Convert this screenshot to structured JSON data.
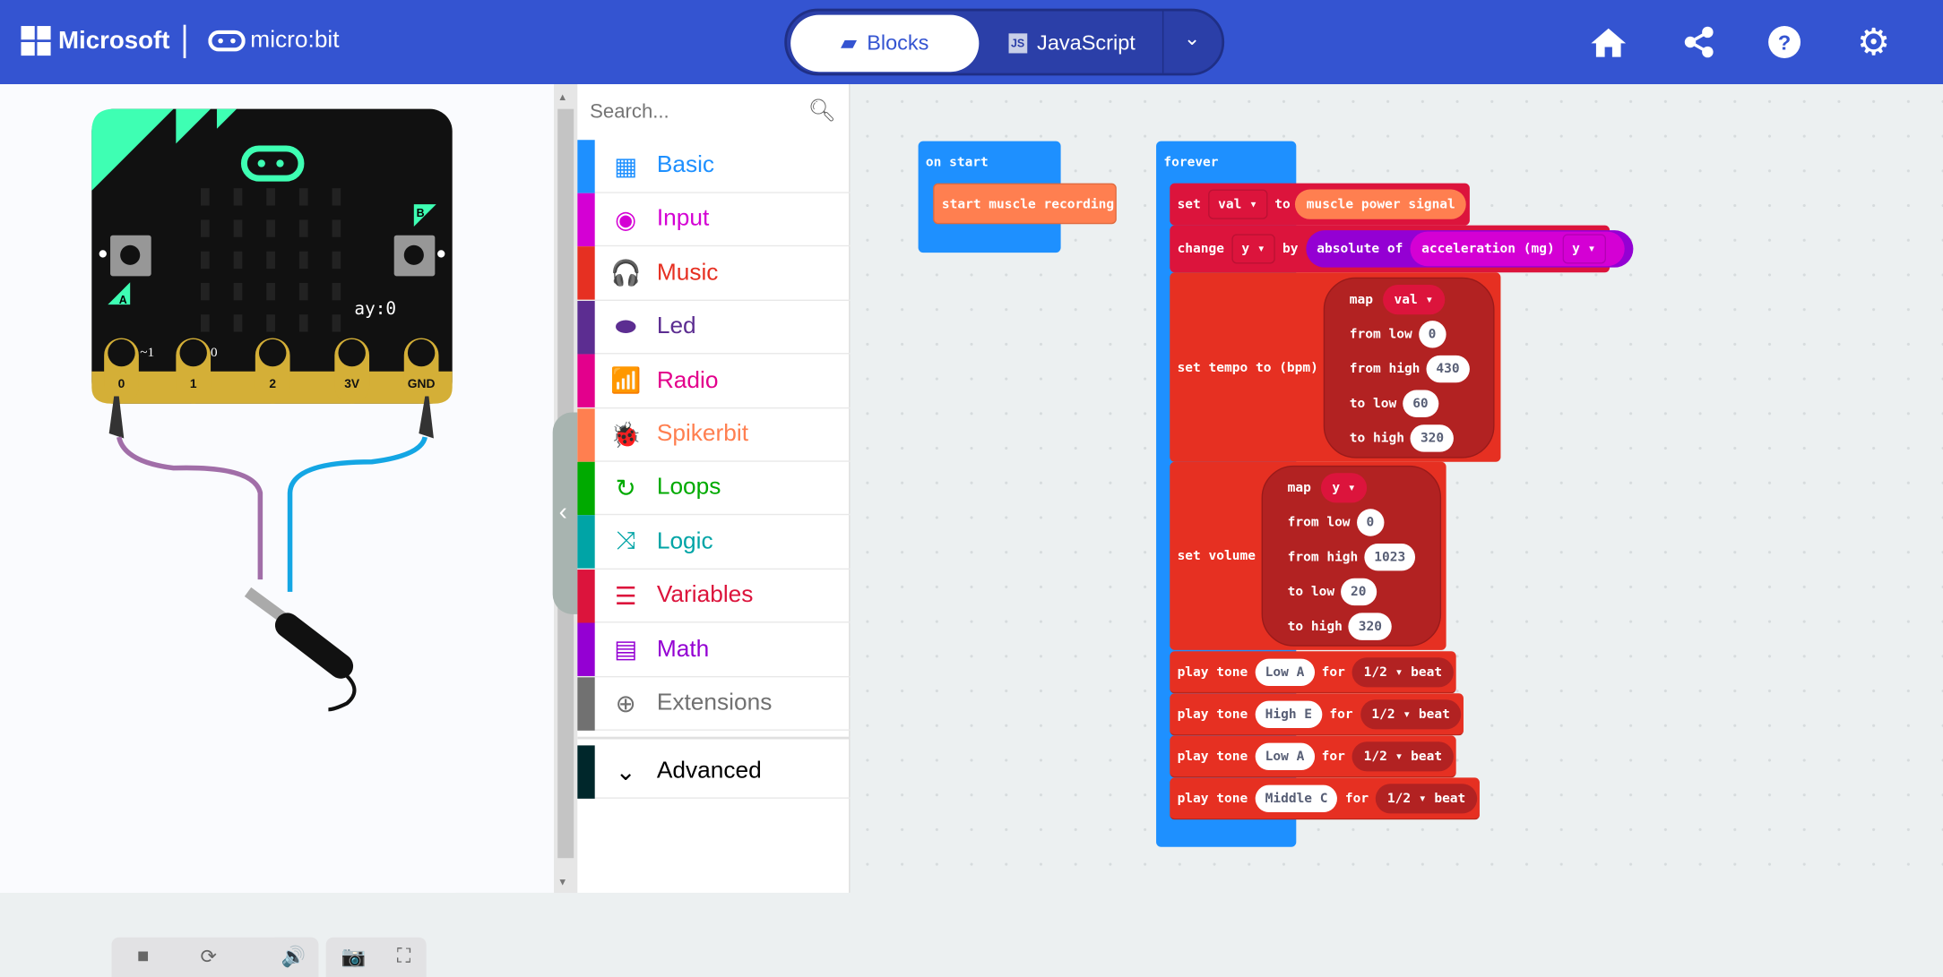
{
  "header": {
    "brand": "Microsoft",
    "product": "micro:bit",
    "tabs": [
      {
        "label": "Blocks",
        "icon": "puzzle-icon"
      },
      {
        "label": "JavaScript",
        "icon": "js-icon"
      }
    ],
    "icons": [
      "home-icon",
      "share-icon",
      "help-icon",
      "settings-icon"
    ],
    "color": "#3454d1"
  },
  "simulator": {
    "readout": "ay:0",
    "pin_labels": [
      "0",
      "1",
      "2",
      "3V",
      "GND"
    ],
    "pin_values": [
      "~1",
      "0"
    ],
    "buttons": [
      "A",
      "B"
    ],
    "controls": [
      "stop-icon",
      "restart-icon",
      "debug-icon",
      "sound-icon",
      "screenshot-icon",
      "fullscreen-icon"
    ]
  },
  "toolbox": {
    "search_placeholder": "Search...",
    "items": [
      {
        "label": "Basic",
        "color": "#1e90ff"
      },
      {
        "label": "Input",
        "color": "#d400d4"
      },
      {
        "label": "Music",
        "color": "#e63022"
      },
      {
        "label": "Led",
        "color": "#5c2d91"
      },
      {
        "label": "Radio",
        "color": "#e3008c"
      },
      {
        "label": "Spikerbit",
        "color": "#ff7f50"
      },
      {
        "label": "Loops",
        "color": "#00aa00"
      },
      {
        "label": "Logic",
        "color": "#00a4a6"
      },
      {
        "label": "Variables",
        "color": "#dc143c"
      },
      {
        "label": "Math",
        "color": "#9400d3"
      },
      {
        "label": "Extensions",
        "color": "#717171"
      }
    ],
    "advanced": "Advanced"
  },
  "workspace": {
    "on_start": {
      "label": "on start",
      "call": "start muscle recording"
    },
    "forever": {
      "label": "forever",
      "set": {
        "kw": "set",
        "var": "val",
        "to": "to",
        "value": "muscle power signal"
      },
      "change": {
        "kw": "change",
        "var": "y",
        "by": "by",
        "abs": "absolute of",
        "accel": "acceleration (mg)",
        "axis": "y"
      },
      "tempo": {
        "label": "set tempo to (bpm)",
        "map": "map",
        "var": "val",
        "from_low_l": "from low",
        "from_low": "0",
        "from_high_l": "from high",
        "from_high": "430",
        "to_low_l": "to low",
        "to_low": "60",
        "to_high_l": "to high",
        "to_high": "320"
      },
      "volume": {
        "label": "set volume",
        "map": "map",
        "var": "y",
        "from_low_l": "from low",
        "from_low": "0",
        "from_high_l": "from high",
        "from_high": "1023",
        "to_low_l": "to low",
        "to_low": "20",
        "to_high_l": "to high",
        "to_high": "320"
      },
      "tones": [
        {
          "kw": "play tone",
          "note": "Low A",
          "for": "for",
          "beat": "1/2",
          "unit": "beat"
        },
        {
          "kw": "play tone",
          "note": "High E",
          "for": "for",
          "beat": "1/2",
          "unit": "beat"
        },
        {
          "kw": "play tone",
          "note": "Low A",
          "for": "for",
          "beat": "1/2",
          "unit": "beat"
        },
        {
          "kw": "play tone",
          "note": "Middle C",
          "for": "for",
          "beat": "1/2",
          "unit": "beat"
        }
      ]
    }
  }
}
